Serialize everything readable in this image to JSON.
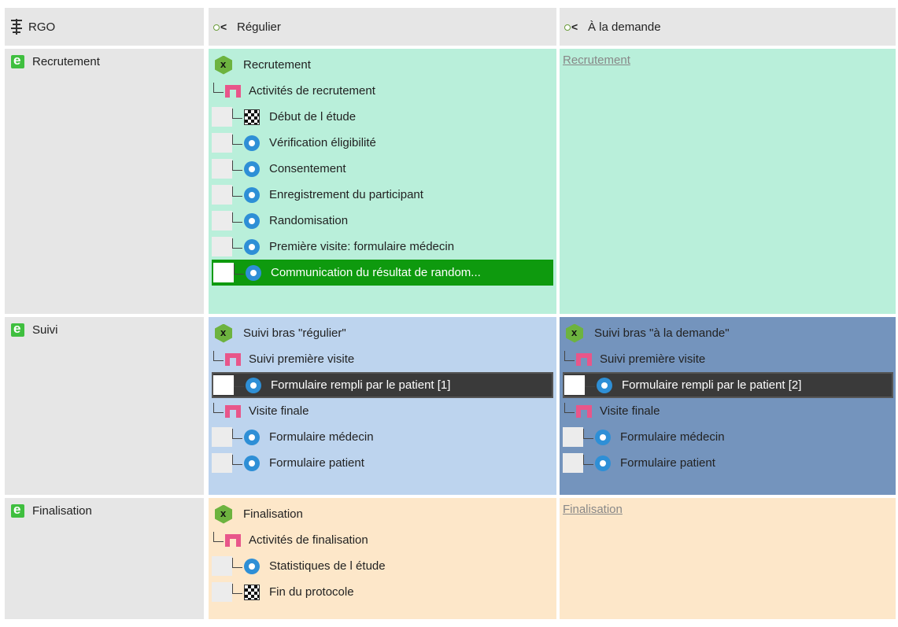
{
  "header": {
    "col1": "RGO",
    "col2": "Régulier",
    "col3": "À la demande"
  },
  "colors": {
    "recrutement": "#b9efda",
    "suivi_regulier": "#bdd4ee",
    "suivi_demande": "#7494bd",
    "finalisation": "#fde7c9",
    "selected_green": "#0e9a0e",
    "selected_dark": "#3a3a3a"
  },
  "phases": [
    {
      "label": "Recrutement",
      "regular": {
        "items": [
          {
            "level": 0,
            "icon": "hexagon-x-icon",
            "text": "Recrutement"
          },
          {
            "level": 1,
            "icon": "network-icon",
            "text": "Activités de recrutement"
          },
          {
            "level": 2,
            "icon": "checkered-flag-start-icon",
            "text": "Début de l étude"
          },
          {
            "level": 2,
            "icon": "gear-icon",
            "text": "Vérification éligibilité"
          },
          {
            "level": 2,
            "icon": "gear-icon",
            "text": "Consentement"
          },
          {
            "level": 2,
            "icon": "gear-icon",
            "text": "Enregistrement du participant"
          },
          {
            "level": 2,
            "icon": "gear-icon",
            "text": "Randomisation"
          },
          {
            "level": 2,
            "icon": "gear-icon",
            "text": "Première visite: formulaire médecin"
          },
          {
            "level": 2,
            "icon": "gear-icon",
            "text": "Communication du résultat de random..."
          }
        ]
      },
      "ondemand_link": "Recrutement"
    },
    {
      "label": "Suivi",
      "regular": {
        "items": [
          {
            "level": 0,
            "icon": "hexagon-x-icon",
            "text": "Suivi bras \"régulier\""
          },
          {
            "level": 1,
            "icon": "network-icon",
            "text": "Suivi première visite"
          },
          {
            "level": 2,
            "icon": "gear-icon",
            "text": "Formulaire rempli par le patient  [1]"
          },
          {
            "level": 1,
            "icon": "network-icon",
            "text": "Visite finale"
          },
          {
            "level": 2,
            "icon": "gear-icon",
            "text": "Formulaire médecin"
          },
          {
            "level": 2,
            "icon": "gear-icon",
            "text": "Formulaire patient"
          }
        ]
      },
      "ondemand": {
        "items": [
          {
            "level": 0,
            "icon": "hexagon-x-icon",
            "text": "Suivi bras \"à la demande\""
          },
          {
            "level": 1,
            "icon": "network-icon",
            "text": "Suivi première visite"
          },
          {
            "level": 2,
            "icon": "gear-icon",
            "text": "Formulaire rempli par le patient  [2]"
          },
          {
            "level": 1,
            "icon": "network-icon",
            "text": "Visite finale"
          },
          {
            "level": 2,
            "icon": "gear-icon",
            "text": "Formulaire médecin"
          },
          {
            "level": 2,
            "icon": "gear-icon",
            "text": "Formulaire patient"
          }
        ]
      }
    },
    {
      "label": "Finalisation",
      "regular": {
        "items": [
          {
            "level": 0,
            "icon": "hexagon-x-icon",
            "text": "Finalisation"
          },
          {
            "level": 1,
            "icon": "network-icon",
            "text": "Activités de finalisation"
          },
          {
            "level": 2,
            "icon": "gear-icon",
            "text": "Statistiques de l étude"
          },
          {
            "level": 2,
            "icon": "checkered-flag-end-icon",
            "text": "Fin du protocole"
          }
        ]
      },
      "ondemand_link": "Finalisation"
    }
  ]
}
